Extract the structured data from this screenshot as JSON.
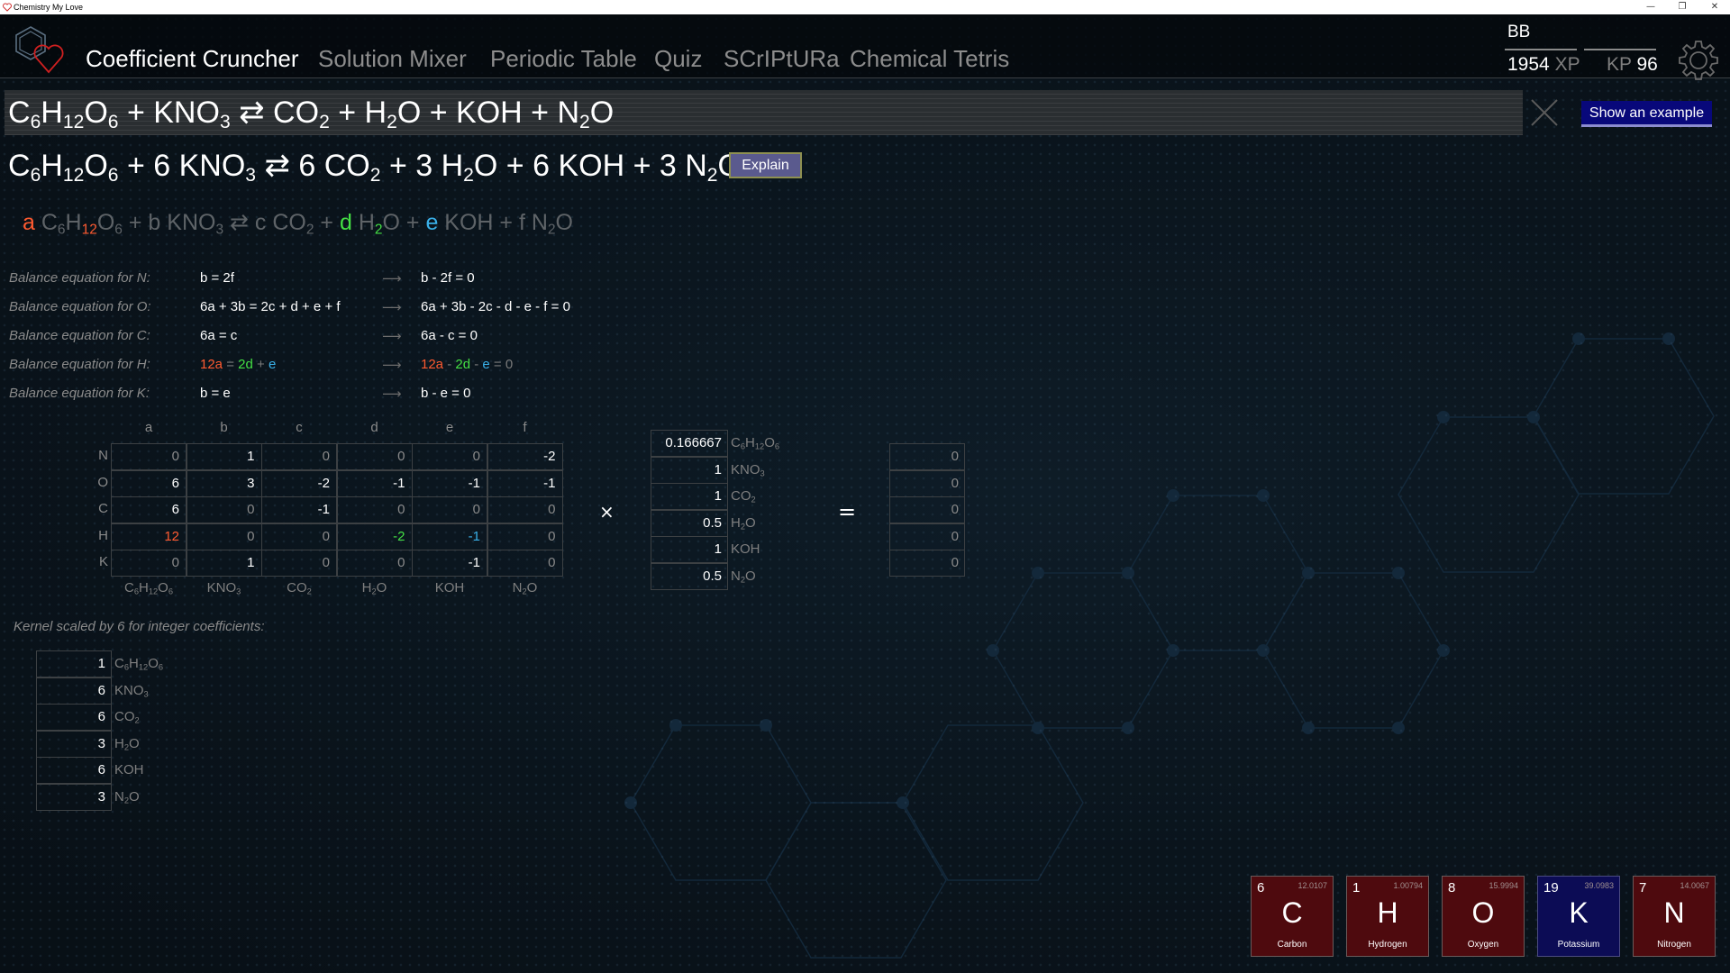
{
  "window": {
    "title": "Chemistry My Love",
    "controls": [
      "minimize",
      "restore",
      "close"
    ]
  },
  "nav": {
    "items": [
      {
        "label": "Coefficient Cruncher",
        "active": true
      },
      {
        "label": "Solution Mixer",
        "active": false
      },
      {
        "label": "Periodic Table",
        "active": false
      },
      {
        "label": "Quiz",
        "active": false
      },
      {
        "label": "SCrIPtURa",
        "active": false
      },
      {
        "label": "Chemical Tetris",
        "active": false
      }
    ]
  },
  "user": {
    "initials": "BB",
    "xp_value": "1954",
    "xp_label": "XP",
    "kp_label": "KP",
    "kp_value": "96"
  },
  "input": {
    "equation": "C6H12O6 + KNO3 ⇄ CO2 + H2O + KOH + N2O",
    "clear_icon": "close-icon"
  },
  "buttons": {
    "show_example": "Show an example",
    "explain": "Explain"
  },
  "balanced": {
    "equation": "C6H12O6 + 6 KNO3 ⇄ 6 CO2 + 3 H2O + 6 KOH + 3 N2O"
  },
  "variable_equation": "a C6H12O6 + b KNO3 ⇄ c CO2 + d H2O + e KOH + f N2O",
  "highlight_colors": {
    "a": "#ff5a30",
    "d": "#44e044",
    "e": "#3ab0e8"
  },
  "balance_equations": [
    {
      "label": "Balance equation for N:",
      "lhs": "b = 2f",
      "arrow": "⟶",
      "rhs": "b - 2f = 0"
    },
    {
      "label": "Balance equation for O:",
      "lhs": "6a + 3b = 2c + d + e + f",
      "arrow": "⟶",
      "rhs": "6a + 3b - 2c - d - e - f = 0"
    },
    {
      "label": "Balance equation for C:",
      "lhs": "6a = c",
      "arrow": "⟶",
      "rhs": "6a - c = 0"
    },
    {
      "label": "Balance equation for H:",
      "lhs": "12a = 2d + e",
      "arrow": "⟶",
      "rhs": "12a - 2d - e = 0"
    },
    {
      "label": "Balance equation for K:",
      "lhs": "b = e",
      "arrow": "⟶",
      "rhs": "b - e = 0"
    }
  ],
  "matrix": {
    "column_vars": [
      "a",
      "b",
      "c",
      "d",
      "e",
      "f"
    ],
    "row_elements": [
      "N",
      "O",
      "C",
      "H",
      "K"
    ],
    "rows": [
      [
        "0",
        "1",
        "0",
        "0",
        "0",
        "-2"
      ],
      [
        "6",
        "3",
        "-2",
        "-1",
        "-1",
        "-1"
      ],
      [
        "6",
        "0",
        "-1",
        "0",
        "0",
        "0"
      ],
      [
        "12",
        "0",
        "0",
        "-2",
        "-1",
        "0"
      ],
      [
        "0",
        "1",
        "0",
        "0",
        "-1",
        "0"
      ]
    ],
    "column_species": [
      "C6H12O6",
      "KNO3",
      "CO2",
      "H2O",
      "KOH",
      "N2O"
    ],
    "times_symbol": "×",
    "equals_symbol": "="
  },
  "kernel_vector": [
    {
      "value": "0.166667",
      "species": "C6H12O6"
    },
    {
      "value": "1",
      "species": "KNO3"
    },
    {
      "value": "1",
      "species": "CO2"
    },
    {
      "value": "0.5",
      "species": "H2O"
    },
    {
      "value": "1",
      "species": "KOH"
    },
    {
      "value": "0.5",
      "species": "N2O"
    }
  ],
  "result_vector": [
    "0",
    "0",
    "0",
    "0",
    "0"
  ],
  "kernel_scaled": {
    "label": "Kernel scaled by 6 for integer coefficients:",
    "items": [
      {
        "value": "1",
        "species": "C6H12O6"
      },
      {
        "value": "6",
        "species": "KNO3"
      },
      {
        "value": "6",
        "species": "CO2"
      },
      {
        "value": "3",
        "species": "H2O"
      },
      {
        "value": "6",
        "species": "KOH"
      },
      {
        "value": "3",
        "species": "N2O"
      }
    ]
  },
  "elements": [
    {
      "number": "6",
      "mass": "12.0107",
      "symbol": "C",
      "name": "Carbon",
      "color": "red"
    },
    {
      "number": "1",
      "mass": "1.00794",
      "symbol": "H",
      "name": "Hydrogen",
      "color": "red"
    },
    {
      "number": "8",
      "mass": "15.9994",
      "symbol": "O",
      "name": "Oxygen",
      "color": "red"
    },
    {
      "number": "19",
      "mass": "39.0983",
      "symbol": "K",
      "name": "Potassium",
      "color": "blue"
    },
    {
      "number": "7",
      "mass": "14.0067",
      "symbol": "N",
      "name": "Nitrogen",
      "color": "red"
    }
  ]
}
